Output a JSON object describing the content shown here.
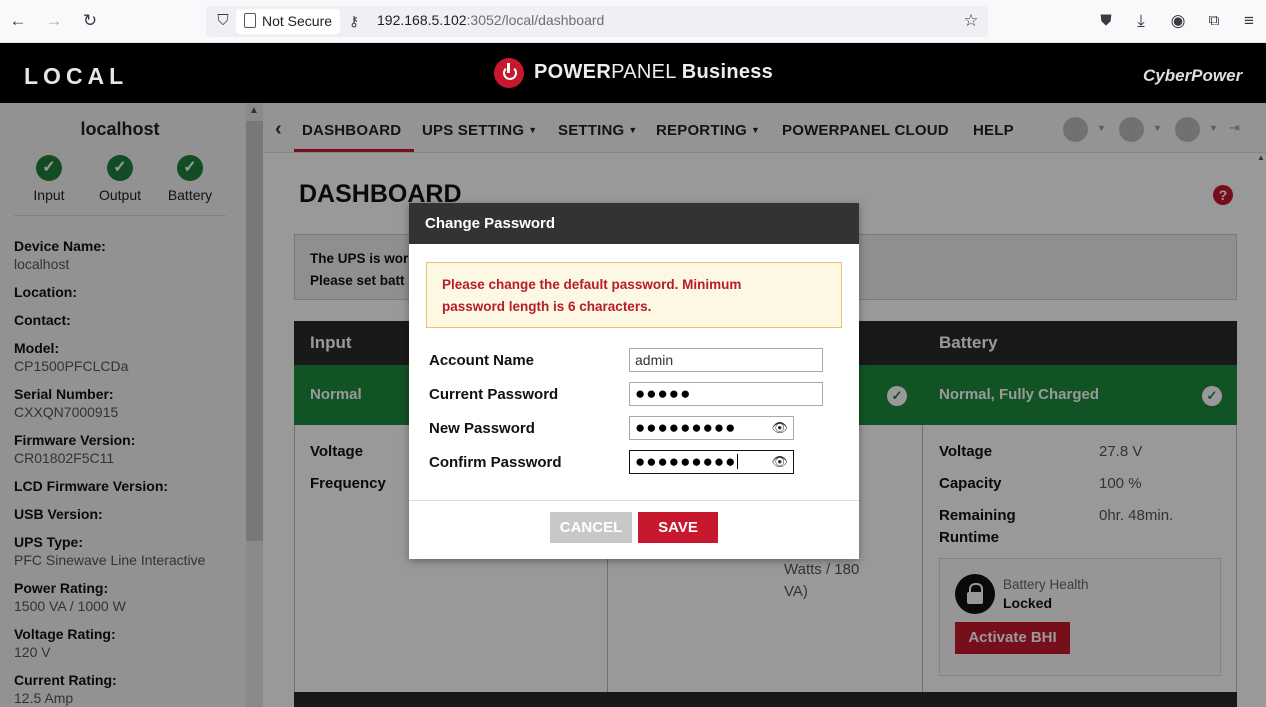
{
  "browser": {
    "security_label": "Not Secure",
    "url_host": "192.168.5.102",
    "url_rest": ":3052/local/dashboard"
  },
  "header": {
    "left_title": "LOCAL",
    "brand_power": "POWER",
    "brand_panel": "PANEL",
    "brand_business": "Business",
    "vendor": "CyberPower"
  },
  "sidebar": {
    "host": "localhost",
    "status": [
      {
        "label": "Input"
      },
      {
        "label": "Output"
      },
      {
        "label": "Battery"
      }
    ],
    "fields": [
      {
        "key": "Device Name:",
        "value": "localhost"
      },
      {
        "key": "Location:",
        "value": ""
      },
      {
        "key": "Contact:",
        "value": ""
      },
      {
        "key": "Model:",
        "value": "CP1500PFCLCDa"
      },
      {
        "key": "Serial Number:",
        "value": "CXXQN7000915"
      },
      {
        "key": "Firmware Version:",
        "value": "CR01802F5C11"
      },
      {
        "key": "LCD Firmware Version:",
        "value": ""
      },
      {
        "key": "USB Version:",
        "value": ""
      },
      {
        "key": "UPS Type:",
        "value": "PFC Sinewave Line Interactive"
      },
      {
        "key": "Power Rating:",
        "value": "1500 VA / 1000 W"
      },
      {
        "key": "Voltage Rating:",
        "value": "120 V"
      },
      {
        "key": "Current Rating:",
        "value": "12.5 Amp"
      }
    ]
  },
  "nav": {
    "items": [
      {
        "label": "DASHBOARD"
      },
      {
        "label": "UPS SETTING"
      },
      {
        "label": "SETTING"
      },
      {
        "label": "REPORTING"
      },
      {
        "label": "POWERPANEL CLOUD"
      },
      {
        "label": "HELP"
      }
    ]
  },
  "main": {
    "title": "DASHBOARD",
    "help_glyph": "?",
    "notice_line1": "The UPS is wor",
    "notice_line2": "Please set batt",
    "input": {
      "header": "Input",
      "status": "Normal",
      "rows": [
        {
          "key": "Voltage"
        },
        {
          "key": "Frequency"
        }
      ]
    },
    "output": {
      "partial_value": "Watts / 180",
      "partial_value2": "VA)"
    },
    "battery": {
      "header": "Battery",
      "status": "Normal, Fully Charged",
      "rows": [
        {
          "key": "Voltage",
          "value": "27.8 V"
        },
        {
          "key": "Capacity",
          "value": "100 %"
        },
        {
          "key": "Remaining",
          "key2": "Runtime",
          "value": "0hr. 48min."
        }
      ],
      "health_label": "Battery Health",
      "health_value": "Locked",
      "activate_label": "Activate BHI"
    }
  },
  "modal": {
    "title": "Change Password",
    "warning_line1": "Please change the default password. Minimum",
    "warning_line2": "password length is 6 characters.",
    "fields": [
      {
        "label": "Account Name",
        "value": "admin"
      },
      {
        "label": "Current Password",
        "value": "●●●●●"
      },
      {
        "label": "New Password",
        "value": "●●●●●●●●●"
      },
      {
        "label": "Confirm Password",
        "value": "●●●●●●●●●"
      }
    ],
    "cancel_label": "CANCEL",
    "save_label": "SAVE"
  },
  "colors": {
    "accent_red": "#c7182d",
    "ok_green": "#1e8a3e",
    "dark_header": "#2b2b2b"
  },
  "icons": [
    "back-arrow-icon",
    "forward-arrow-icon",
    "reload-icon",
    "shield-icon",
    "page-icon",
    "key-icon",
    "star-icon",
    "pocket-icon",
    "download-icon",
    "account-icon",
    "extensions-icon",
    "menu-icon",
    "power-logo-icon",
    "checkmark-icon",
    "help-icon",
    "lock-icon",
    "eye-icon"
  ]
}
